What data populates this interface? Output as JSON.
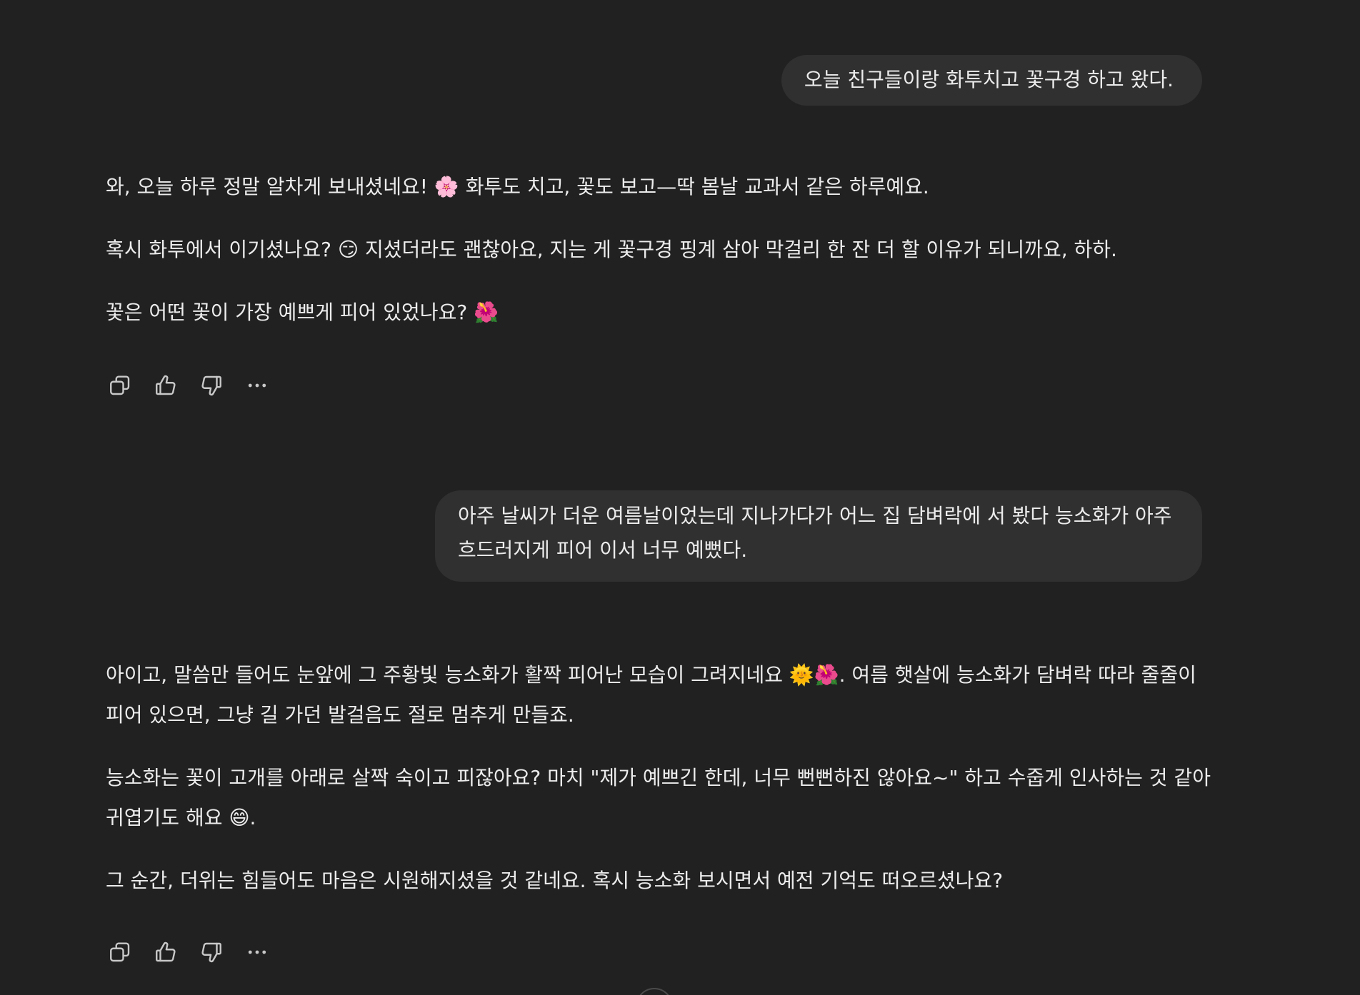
{
  "conversation": {
    "messages": [
      {
        "role": "user",
        "text": "오늘 친구들이랑 화투치고 꽃구경 하고 왔다."
      },
      {
        "role": "assistant",
        "paragraphs": [
          "와, 오늘 하루 정말 알차게 보내셨네요! 🌸 화투도 치고, 꽃도 보고—딱 봄날 교과서 같은 하루예요.",
          "혹시 화투에서 이기셨나요? 😏 지셨더라도 괜찮아요, 지는 게 꽃구경 핑계 삼아 막걸리 한 잔 더 할 이유가 되니까요, 하하.",
          "꽃은 어떤 꽃이 가장 예쁘게 피어 있었나요? 🌺"
        ]
      },
      {
        "role": "user",
        "text": "아주 날씨가 더운 여름날이었는데 지나가다가 어느 집 담벼락에 서 봤다 능소화가 아주 흐드러지게 피어 이서 너무 예뻤다."
      },
      {
        "role": "assistant",
        "paragraphs": [
          "아이고, 말씀만 들어도 눈앞에 그 주황빛 능소화가 활짝 피어난 모습이 그려지네요 🌞🌺. 여름 햇살에 능소화가 담벼락 따라 줄줄이 피어 있으면, 그냥 길 가던 발걸음도 절로 멈추게 만들죠.",
          "능소화는 꽃이 고개를 아래로 살짝 숙이고 피잖아요? 마치 \"제가 예쁘긴 한데, 너무 뻔뻔하진 않아요~\" 하고 수줍게 인사하는 것 같아 귀엽기도 해요 😄.",
          "그 순간, 더위는 힘들어도 마음은 시원해지셨을 것 같네요. 혹시 능소화 보시면서 예전 기억도 떠오르셨나요?"
        ]
      }
    ],
    "action_icons": [
      "copy-icon",
      "thumbs-up-icon",
      "thumbs-down-icon",
      "more-icon"
    ]
  },
  "colors": {
    "background": "#212121",
    "user_bubble": "#303030",
    "text": "#ececec",
    "icon": "#c8c8c8"
  }
}
